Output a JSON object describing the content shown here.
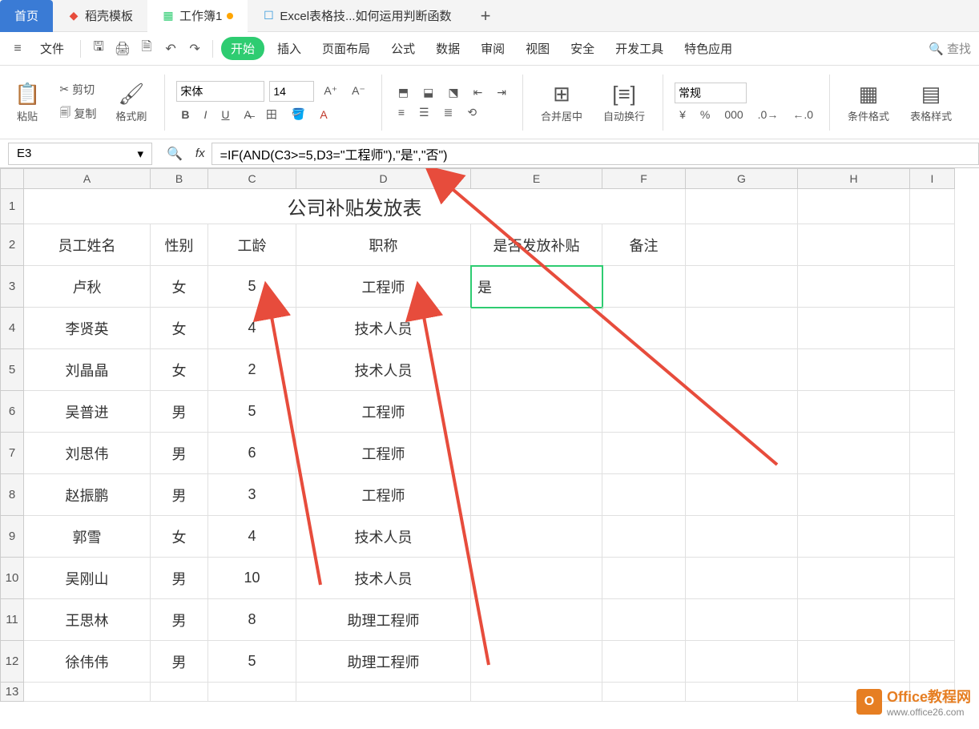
{
  "tabs": {
    "home": "首页",
    "tab1": "稻壳模板",
    "tab2": "工作簿1",
    "tab3": "Excel表格技...如何运用判断函数",
    "plus": "+"
  },
  "menu": {
    "file": "文件",
    "start": "开始",
    "insert": "插入",
    "layout": "页面布局",
    "formula": "公式",
    "data": "数据",
    "review": "审阅",
    "view": "视图",
    "security": "安全",
    "dev": "开发工具",
    "special": "特色应用",
    "search": "查找"
  },
  "ribbon": {
    "paste": "粘贴",
    "cut": "剪切",
    "copy": "复制",
    "format_painter": "格式刷",
    "font": "宋体",
    "size": "14",
    "merge": "合并居中",
    "wrap": "自动换行",
    "normal": "常规",
    "cond_format": "条件格式",
    "table_style": "表格样式"
  },
  "namebox": "E3",
  "formula": "=IF(AND(C3>=5,D3=\"工程师\"),\"是\",\"否\")",
  "title": "公司补贴发放表",
  "headers": [
    "员工姓名",
    "性别",
    "工龄",
    "职称",
    "是否发放补贴",
    "备注"
  ],
  "data": [
    {
      "name": "卢秋",
      "gender": "女",
      "years": "5",
      "title": "工程师",
      "subsidy": "是"
    },
    {
      "name": "李贤英",
      "gender": "女",
      "years": "4",
      "title": "技术人员",
      "subsidy": ""
    },
    {
      "name": "刘晶晶",
      "gender": "女",
      "years": "2",
      "title": "技术人员",
      "subsidy": ""
    },
    {
      "name": "吴普进",
      "gender": "男",
      "years": "5",
      "title": "工程师",
      "subsidy": ""
    },
    {
      "name": "刘思伟",
      "gender": "男",
      "years": "6",
      "title": "工程师",
      "subsidy": ""
    },
    {
      "name": "赵振鹏",
      "gender": "男",
      "years": "3",
      "title": "工程师",
      "subsidy": ""
    },
    {
      "name": "郭雪",
      "gender": "女",
      "years": "4",
      "title": "技术人员",
      "subsidy": ""
    },
    {
      "name": "吴刚山",
      "gender": "男",
      "years": "10",
      "title": "技术人员",
      "subsidy": ""
    },
    {
      "name": "王思林",
      "gender": "男",
      "years": "8",
      "title": "助理工程师",
      "subsidy": ""
    },
    {
      "name": "徐伟伟",
      "gender": "男",
      "years": "5",
      "title": "助理工程师",
      "subsidy": ""
    }
  ],
  "cols": [
    "A",
    "B",
    "C",
    "D",
    "E",
    "F",
    "G",
    "H",
    "I"
  ],
  "watermark": {
    "brand": "Office教程网",
    "url": "www.office26.com",
    "logo": "O"
  }
}
